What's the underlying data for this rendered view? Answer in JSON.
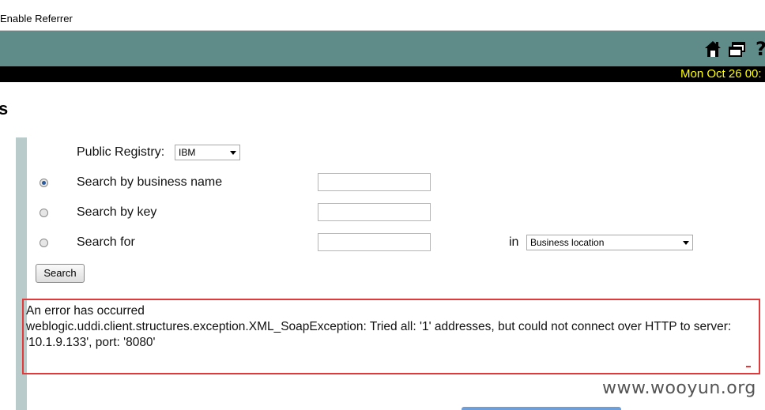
{
  "toolbar": {
    "enable_referrer": "Enable Referrer"
  },
  "header": {
    "icons": [
      "home-icon",
      "windows-icon",
      "help-icon"
    ],
    "date": "Mon Oct 26 00:"
  },
  "page": {
    "title_fragment": "s"
  },
  "form": {
    "registry_label": "Public Registry:",
    "registry_value": "IBM",
    "options": [
      {
        "label": "Search by business name",
        "checked": true
      },
      {
        "label": "Search by key",
        "checked": false
      },
      {
        "label": "Search for",
        "checked": false
      }
    ],
    "in_label": "in",
    "in_value": "Business location",
    "search_button": "Search"
  },
  "error": {
    "line1": "An error has occurred",
    "line2": "weblogic.uddi.client.structures.exception.XML_SoapException: Tried all: '1' addresses, but could not connect over HTTP to server:",
    "line3": "'10.1.9.133', port: '8080'"
  },
  "watermark": "www.wooyun.org",
  "colors": {
    "teal": "#5f8b89",
    "error_border": "#e23a3a",
    "date_text": "#ffff00"
  }
}
